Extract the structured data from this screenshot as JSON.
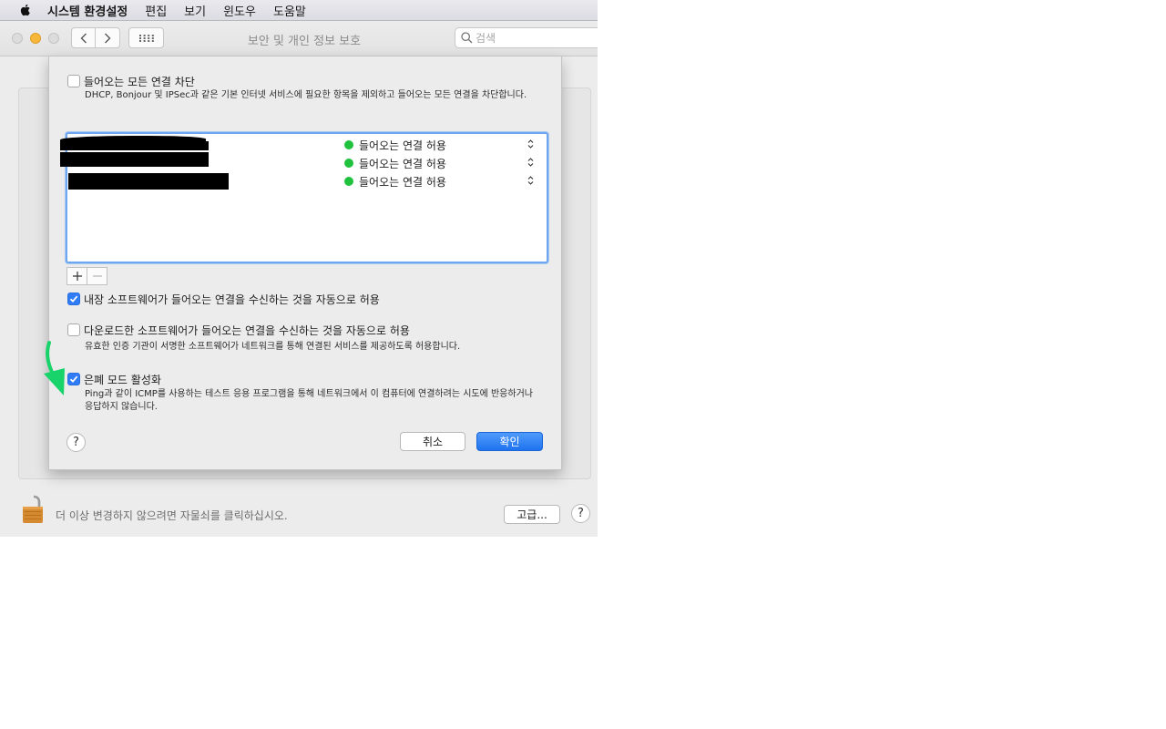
{
  "menubar": {
    "app_name": "시스템 환경설정",
    "items": [
      "편집",
      "보기",
      "윈도우",
      "도움말"
    ]
  },
  "window": {
    "title": "보안 및 개인 정보 보호",
    "search": {
      "placeholder": "검색",
      "value": ""
    }
  },
  "firewall_options": {
    "block_all": {
      "label": "들어오는 모든 연결 차단",
      "checked": false,
      "description": "DHCP, Bonjour 및 IPSec과 같은 기본 인터넷 서비스에 필요한 항목을 제외하고 들어오는 모든 연결을 차단합니다."
    },
    "app_list": [
      {
        "name": "",
        "status": "들어오는 연결 허용",
        "status_color": "#1fc23d"
      },
      {
        "name": "",
        "status": "들어오는 연결 허용",
        "status_color": "#1fc23d"
      },
      {
        "name": "",
        "status": "들어오는 연결 허용",
        "status_color": "#1fc23d"
      }
    ],
    "builtin_software": {
      "label": "내장 소프트웨어가 들어오는 연결을 수신하는 것을 자동으로 허용",
      "checked": true
    },
    "downloaded_software": {
      "label": "다운로드한 소프트웨어가 들어오는 연결을 수신하는 것을 자동으로 허용",
      "checked": false,
      "description": "유효한 인증 기관이 서명한 소프트웨어가 네트워크를 통해 연결된 서비스를 제공하도록 허용합니다."
    },
    "stealth_mode": {
      "label": "은폐 모드 활성화",
      "checked": true,
      "description": "Ping과 같이 ICMP를 사용하는 테스트 응용 프로그램을 통해 네트워크에서 이 컴퓨터에 연결하려는 시도에 반응하거나 응답하지 않습니다."
    },
    "help_label": "?",
    "cancel_label": "취소",
    "ok_label": "확인"
  },
  "footer": {
    "lock_text": "더 이상 변경하지 않으려면 자물쇠를 클릭하십시오.",
    "advanced_label": "고급...",
    "help_label": "?"
  },
  "colors": {
    "accent": "#2f7cf6",
    "annotation_arrow": "#18d36a"
  }
}
